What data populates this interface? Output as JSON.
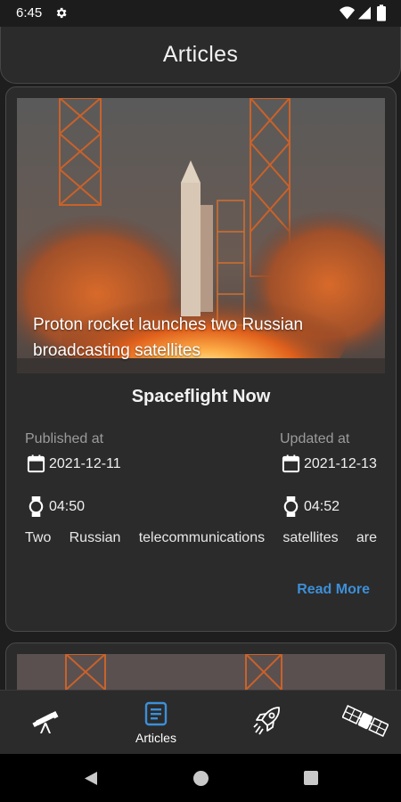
{
  "status_bar": {
    "time": "6:45"
  },
  "header": {
    "title": "Articles"
  },
  "articles": [
    {
      "image_caption": "Proton rocket launches two Russian broadcasting satellites",
      "source": "Spaceflight Now",
      "published_label": "Published at",
      "published_date": "2021-12-11",
      "published_time": "04:50",
      "updated_label": "Updated at",
      "updated_date": "2021-12-13",
      "updated_time": "04:52",
      "description": "Two Russian telecommunications satellites are",
      "read_more": "Read More"
    }
  ],
  "bottom_nav": {
    "items": [
      {
        "icon": "telescope-icon",
        "label": ""
      },
      {
        "icon": "articles-icon",
        "label": "Articles",
        "active": true
      },
      {
        "icon": "rocket-icon",
        "label": ""
      },
      {
        "icon": "satellite-icon",
        "label": ""
      }
    ]
  },
  "colors": {
    "accent": "#3d8fd8",
    "background": "#1e1e1e",
    "card": "#2b2b2b"
  }
}
